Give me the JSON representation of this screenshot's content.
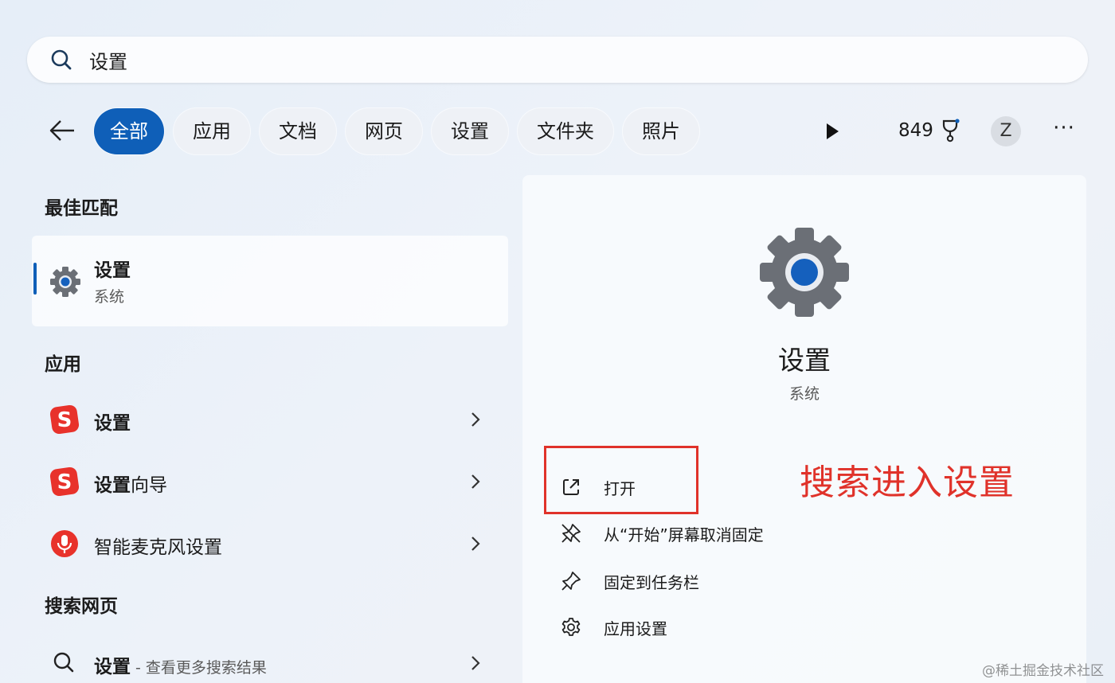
{
  "search": {
    "value": "设置"
  },
  "filters": [
    {
      "label": "全部",
      "active": true
    },
    {
      "label": "应用"
    },
    {
      "label": "文档"
    },
    {
      "label": "网页"
    },
    {
      "label": "设置"
    },
    {
      "label": "文件夹"
    },
    {
      "label": "照片"
    }
  ],
  "toolbar": {
    "points": "849",
    "avatar_letter": "Z",
    "more": "···"
  },
  "sections": {
    "best_match": "最佳匹配",
    "apps": "应用",
    "web": "搜索网页"
  },
  "best_match": {
    "name": "设置",
    "type": "系统"
  },
  "apps": [
    {
      "name_bold": "设置",
      "name_rest": ""
    },
    {
      "name_bold": "设置",
      "name_rest": "向导"
    },
    {
      "name_bold": "",
      "name_rest": "智能麦克风设置"
    }
  ],
  "web_result": {
    "query": "设置",
    "hint": " - 查看更多搜索结果"
  },
  "detail": {
    "name": "设置",
    "type": "系统",
    "actions": [
      {
        "label": "打开",
        "icon": "open-external-icon"
      },
      {
        "label": "从“开始”屏幕取消固定",
        "icon": "unpin-icon"
      },
      {
        "label": "固定到任务栏",
        "icon": "pin-icon"
      },
      {
        "label": "应用设置",
        "icon": "gear-outline-icon"
      }
    ]
  },
  "annotation": {
    "text": "搜索进入设置"
  },
  "watermark": "@稀土掘金技术社区",
  "colors": {
    "accent": "#0f5fb8",
    "annotation": "#e0322a",
    "sogou_red": "#e8322b"
  }
}
